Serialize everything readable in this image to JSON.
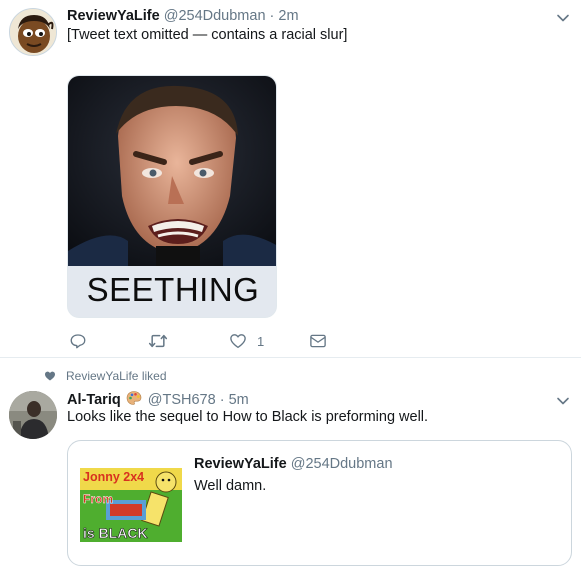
{
  "tweets": [
    {
      "name": "ReviewYaLife",
      "handle": "@254Ddubman",
      "time": "2m",
      "text": "[Tweet text omitted — contains a racial slur]",
      "media": {
        "caption": "SEETHING"
      },
      "actions": {
        "like_count": "1"
      },
      "icons": [
        "reply-icon",
        "retweet-icon",
        "heart-icon",
        "envelope-icon",
        "chevron-down-icon"
      ]
    },
    {
      "liked_by": "ReviewYaLife liked",
      "name": "Al-Tariq",
      "handle": "@TSH678",
      "time": "5m",
      "text": "Looks like the sequel to How to Black is preforming well.",
      "quote": {
        "name": "ReviewYaLife",
        "handle": "@254Ddubman",
        "text": "Well damn.",
        "thumbnail_text": [
          "Jonny 2x4",
          "From",
          "is BLACK"
        ]
      }
    }
  ],
  "separator": "·",
  "colors": {
    "text": "#14171a",
    "secondary": "#657786",
    "border": "#e6ecf0"
  }
}
